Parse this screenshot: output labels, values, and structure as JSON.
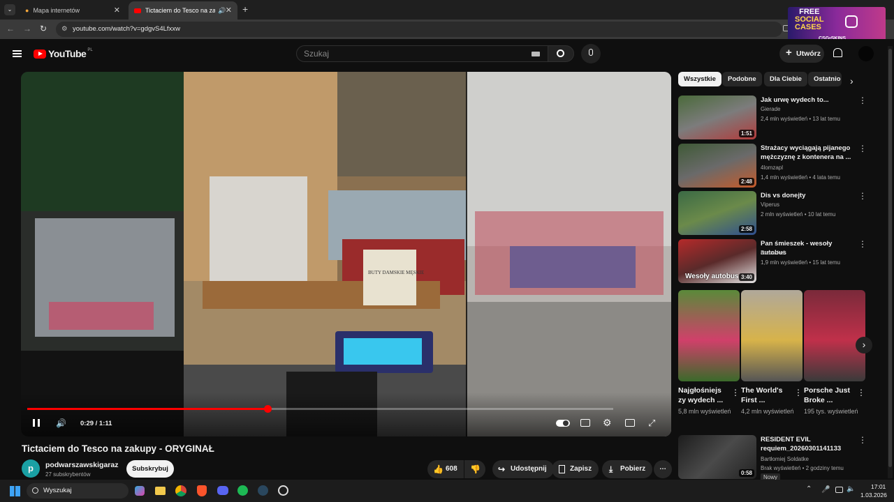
{
  "tabs": [
    {
      "label": "Mapa internetów"
    },
    {
      "label": "Tictaciem do Tesco na zaku"
    }
  ],
  "url": "youtube.com/watch?v=gdgvS4Lfxxw",
  "ad": {
    "line1": "FREE",
    "line2": "SOCIAL",
    "line3": "CASES",
    "brand": "CSG•SKINS"
  },
  "header": {
    "logo": "YouTube",
    "region": "PL",
    "search_placeholder": "Szukaj",
    "create": "Utwórz"
  },
  "player": {
    "time": "0:29 / 1:11",
    "sign_text": "BUTY DAMSKIE MĘSKIE",
    "progress": 0.41
  },
  "video": {
    "title": "Tictaciem do Tesco na zakupy - ORYGINAŁ",
    "channel": "podwarszawskigaraz",
    "subscribers": "27 subskrybentów",
    "avatar_letter": "p",
    "subscribe": "Subskrybuj",
    "likes": "608",
    "share": "Udostępnij",
    "save": "Zapisz",
    "download": "Pobierz"
  },
  "chips": [
    "Wszystkie",
    "Podobne",
    "Dla Ciebie",
    "Ostatnio"
  ],
  "recommendations": [
    {
      "title": "Jak urwę wydech to...",
      "channel": "Gierade",
      "meta": "2,4 mln wyświetleń • 13 lat temu",
      "duration": "1:51",
      "colors": [
        "#4a6a3a",
        "#b23b3b",
        "#7c7c7c"
      ]
    },
    {
      "title": "Strażacy wyciągają pijanego mężczyznę z kontenera na ...",
      "channel": "4lomzapl",
      "meta": "1,4 mln wyświetleń • 4 lata temu",
      "duration": "2:48",
      "colors": [
        "#3f5a36",
        "#c65b2a",
        "#6a6a6a"
      ]
    },
    {
      "title": "Dis vs donejty",
      "channel": "Viperus",
      "meta": "2 mln wyświetleń • 10 lat temu",
      "duration": "2:58",
      "colors": [
        "#3b6a45",
        "#2f4f8f",
        "#6b8a4a"
      ]
    },
    {
      "title": "Pan śmieszek - wesoły autobus",
      "channel": "Psaawkel",
      "meta": "1,9 mln wyświetleń • 15 lat temu",
      "duration": "3:40",
      "overlay": "Wesoły autobus",
      "colors": [
        "#b52a2a",
        "#e6e6e6",
        "#5a2a2a"
      ]
    }
  ],
  "shorts": [
    {
      "title": "Najgłośniejs zy wydech ...",
      "views": "5,8 mln wyświetleń",
      "colors": [
        "#5a8a3a",
        "#d0406a",
        "#3a6a2a"
      ]
    },
    {
      "title": "The World's First ...",
      "views": "4,2 mln wyświetleń",
      "colors": [
        "#b0a89a",
        "#d7b34a",
        "#555"
      ]
    },
    {
      "title": "Porsche Just Broke ...",
      "views": "195 tys. wyświetleń",
      "colors": [
        "#7a2a3a",
        "#c0304a",
        "#3a3a3a"
      ]
    }
  ],
  "last": {
    "title": "RESIDENT EVIL requiem_20260301141133",
    "channel": "Bartłomiej Soldatke",
    "meta": "Brak wyświetleń • 2 godziny temu",
    "badge": "Nowy",
    "duration": "0:58"
  },
  "taskbar": {
    "search": "Wyszukaj",
    "time": "17:01",
    "date": "1.03.2026"
  }
}
